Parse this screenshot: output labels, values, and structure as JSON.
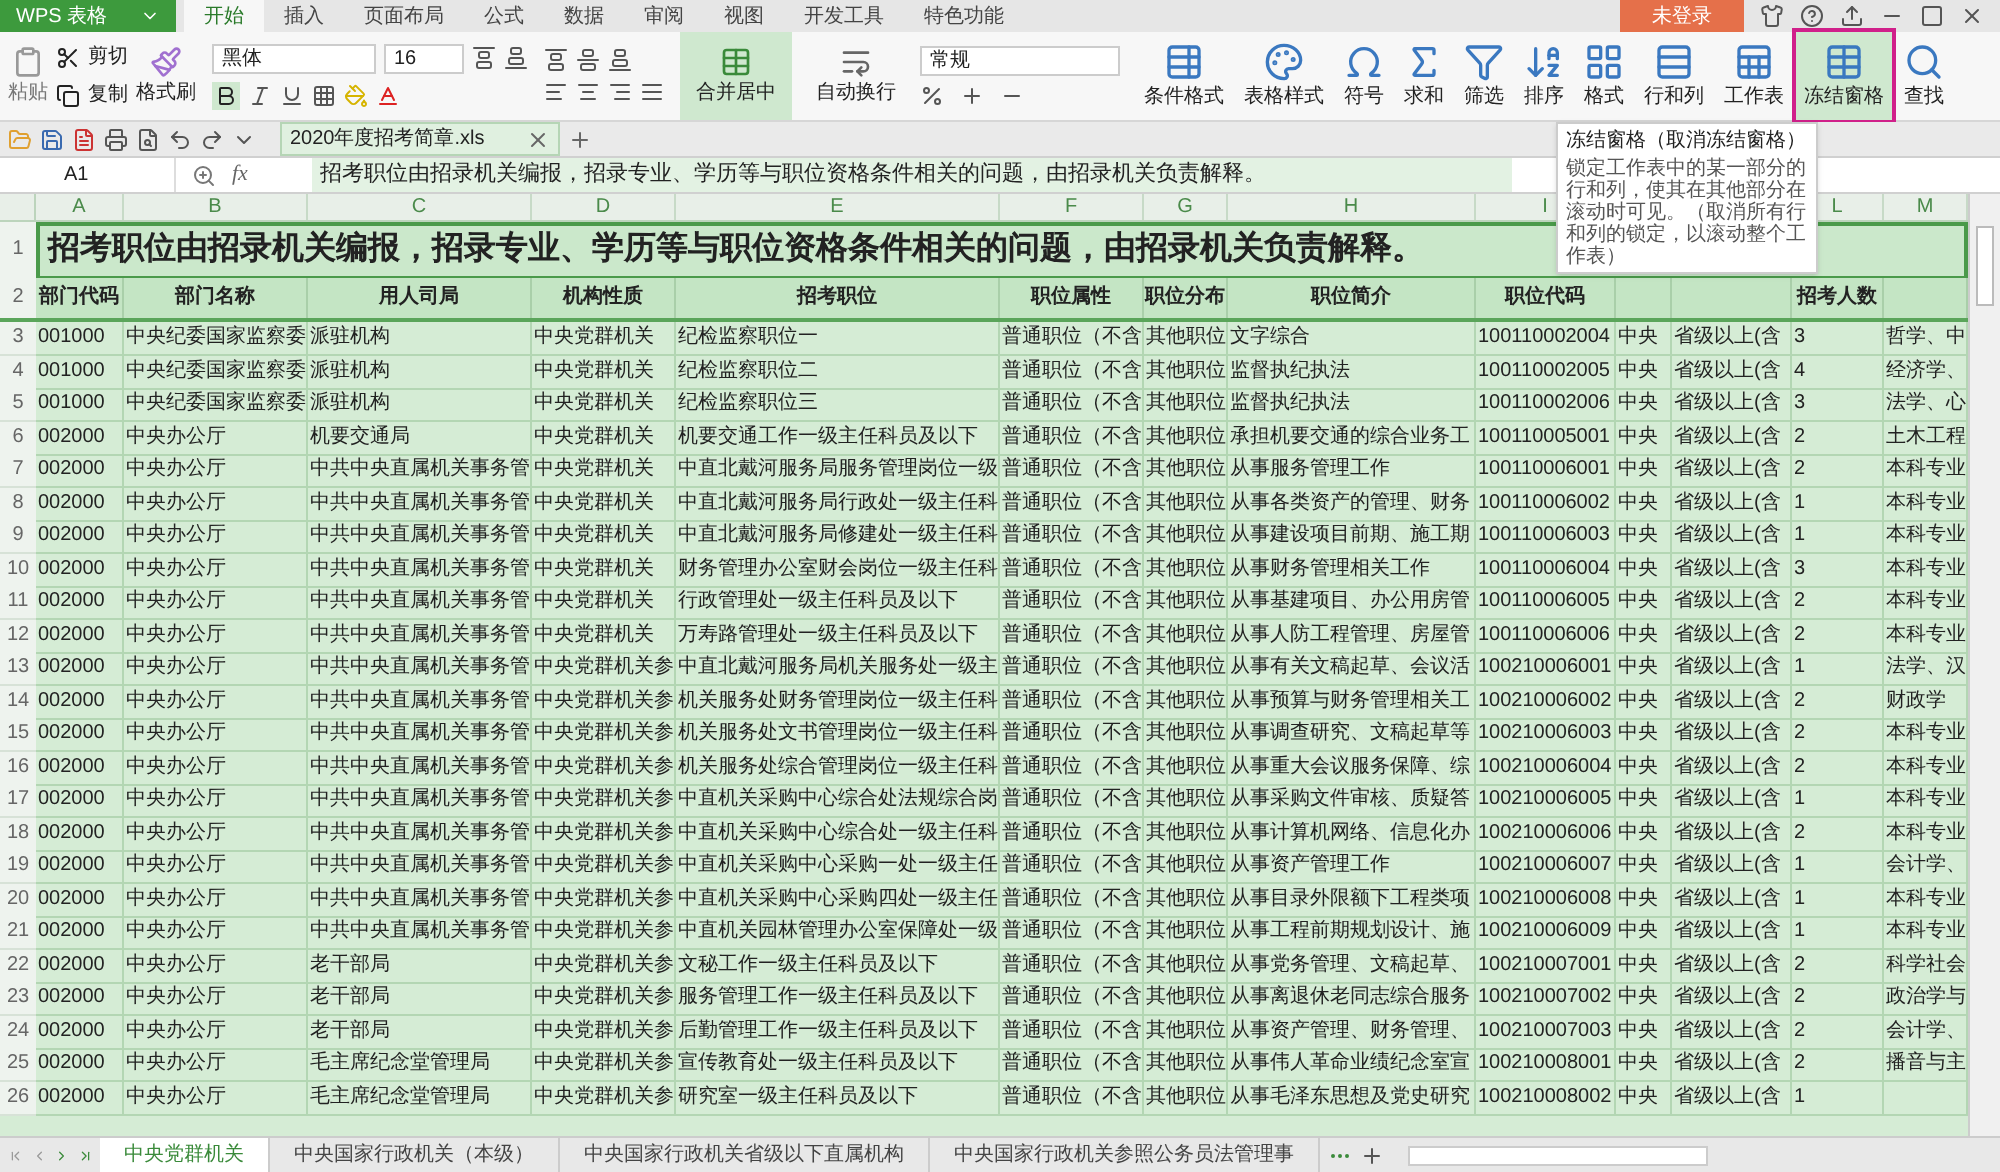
{
  "app": {
    "name": "WPS 表格"
  },
  "menu_tabs": [
    {
      "label": "开始",
      "selected": true
    },
    {
      "label": "插入",
      "selected": false
    },
    {
      "label": "页面布局",
      "selected": false
    },
    {
      "label": "公式",
      "selected": false
    },
    {
      "label": "数据",
      "selected": false
    },
    {
      "label": "审阅",
      "selected": false
    },
    {
      "label": "视图",
      "selected": false
    },
    {
      "label": "开发工具",
      "selected": false
    },
    {
      "label": "特色功能",
      "selected": false
    }
  ],
  "login_button": "未登录",
  "ribbon": {
    "paste": "粘贴",
    "cut": "剪切",
    "copy": "复制",
    "format_painter": "格式刷",
    "font_name": "黑体",
    "font_size": "16",
    "bold": true,
    "merge": {
      "label": "合并居中",
      "selected": true
    },
    "wrap": {
      "label": "自动换行",
      "selected": false
    },
    "number_format": "常规",
    "tools": [
      {
        "kind": "conditional",
        "label": "条件格式",
        "selected": false
      },
      {
        "kind": "style",
        "label": "表格样式",
        "selected": false
      },
      {
        "kind": "symbol",
        "label": "符号",
        "selected": false
      },
      {
        "kind": "sum",
        "label": "求和",
        "selected": false
      },
      {
        "kind": "filter",
        "label": "筛选",
        "selected": false
      },
      {
        "kind": "sort",
        "label": "排序",
        "selected": false
      },
      {
        "kind": "format",
        "label": "格式",
        "selected": false
      },
      {
        "kind": "rowcol",
        "label": "行和列",
        "selected": false
      },
      {
        "kind": "sheet",
        "label": "工作表",
        "selected": false
      },
      {
        "kind": "freeze",
        "label": "冻结窗格",
        "selected": true
      },
      {
        "kind": "find",
        "label": "查找",
        "selected": false
      }
    ]
  },
  "document_tab": {
    "title": "2020年度招考简章.xls"
  },
  "formula_bar": {
    "cell": "A1",
    "fx": "fx",
    "content": "招考职位由招录机关编报，招录专业、学历等与职位资格条件相关的问题，由招录机关负责解释。"
  },
  "tooltip": {
    "title": "冻结窗格（取消冻结窗格）",
    "body": "锁定工作表中的某一部分的行和列，使其在其他部分在滚动时可见。（取消所有行和列的锁定，以滚动整个工作表）"
  },
  "sheet": {
    "columns": [
      "A",
      "B",
      "C",
      "D",
      "E",
      "F",
      "G",
      "H",
      "I",
      null,
      null,
      "L",
      "M"
    ],
    "title_row": {
      "num": "1",
      "text": "招考职位由招录机关编报，招录专业、学历等与职位资格条件相关的问题，由招录机关负责解释。"
    },
    "header_row": {
      "num": "2",
      "cells": [
        "部门代码",
        "部门名称",
        "用人司局",
        "机构性质",
        "招考职位",
        "职位属性",
        "职位分布",
        "职位简介",
        "职位代码",
        null,
        null,
        "招考人数"
      ]
    },
    "rows": [
      {
        "num": "3",
        "cells": [
          "001000",
          "中央纪委国家监察委",
          "派驻机构",
          "中央党群机关",
          "纪检监察职位一",
          "普通职位（不含",
          "其他职位",
          "文字综合",
          "100110002004",
          "中央",
          "省级以上(含",
          "3",
          "哲学、中"
        ]
      },
      {
        "num": "4",
        "cells": [
          "001000",
          "中央纪委国家监察委",
          "派驻机构",
          "中央党群机关",
          "纪检监察职位二",
          "普通职位（不含",
          "其他职位",
          "监督执纪执法",
          "100110002005",
          "中央",
          "省级以上(含",
          "4",
          "经济学、"
        ]
      },
      {
        "num": "5",
        "cells": [
          "001000",
          "中央纪委国家监察委",
          "派驻机构",
          "中央党群机关",
          "纪检监察职位三",
          "普通职位（不含",
          "其他职位",
          "监督执纪执法",
          "100110002006",
          "中央",
          "省级以上(含",
          "3",
          "法学、心"
        ]
      },
      {
        "num": "6",
        "cells": [
          "002000",
          "中央办公厅",
          "机要交通局",
          "中央党群机关",
          "机要交通工作一级主任科员及以下",
          "普通职位（不含",
          "其他职位",
          "承担机要交通的综合业务工",
          "100110005001",
          "中央",
          "省级以上(含",
          "2",
          "土木工程"
        ]
      },
      {
        "num": "7",
        "cells": [
          "002000",
          "中央办公厅",
          "中共中央直属机关事务管",
          "中央党群机关",
          "中直北戴河服务局服务管理岗位一级",
          "普通职位（不含",
          "其他职位",
          "从事服务管理工作",
          "100110006001",
          "中央",
          "省级以上(含",
          "2",
          "本科专业"
        ]
      },
      {
        "num": "8",
        "cells": [
          "002000",
          "中央办公厅",
          "中共中央直属机关事务管",
          "中央党群机关",
          "中直北戴河服务局行政处一级主任科",
          "普通职位（不含",
          "其他职位",
          "从事各类资产的管理、财务",
          "100110006002",
          "中央",
          "省级以上(含",
          "1",
          "本科专业"
        ]
      },
      {
        "num": "9",
        "cells": [
          "002000",
          "中央办公厅",
          "中共中央直属机关事务管",
          "中央党群机关",
          "中直北戴河服务局修建处一级主任科",
          "普通职位（不含",
          "其他职位",
          "从事建设项目前期、施工期",
          "100110006003",
          "中央",
          "省级以上(含",
          "1",
          "本科专业"
        ]
      },
      {
        "num": "10",
        "cells": [
          "002000",
          "中央办公厅",
          "中共中央直属机关事务管",
          "中央党群机关",
          "财务管理办公室财会岗位一级主任科",
          "普通职位（不含",
          "其他职位",
          "从事财务管理相关工作",
          "100110006004",
          "中央",
          "省级以上(含",
          "3",
          "本科专业"
        ]
      },
      {
        "num": "11",
        "cells": [
          "002000",
          "中央办公厅",
          "中共中央直属机关事务管",
          "中央党群机关",
          "行政管理处一级主任科员及以下",
          "普通职位（不含",
          "其他职位",
          "从事基建项目、办公用房管",
          "100110006005",
          "中央",
          "省级以上(含",
          "2",
          "本科专业"
        ]
      },
      {
        "num": "12",
        "cells": [
          "002000",
          "中央办公厅",
          "中共中央直属机关事务管",
          "中央党群机关",
          "万寿路管理处一级主任科员及以下",
          "普通职位（不含",
          "其他职位",
          "从事人防工程管理、房屋管",
          "100110006006",
          "中央",
          "省级以上(含",
          "2",
          "本科专业"
        ]
      },
      {
        "num": "13",
        "cells": [
          "002000",
          "中央办公厅",
          "中共中央直属机关事务管",
          "中央党群机关参",
          "中直北戴河服务局机关服务处一级主",
          "普通职位（不含",
          "其他职位",
          "从事有关文稿起草、会议活",
          "100210006001",
          "中央",
          "省级以上(含",
          "1",
          "法学、汉"
        ]
      },
      {
        "num": "14",
        "cells": [
          "002000",
          "中央办公厅",
          "中共中央直属机关事务管",
          "中央党群机关参",
          "机关服务处财务管理岗位一级主任科",
          "普通职位（不含",
          "其他职位",
          "从事预算与财务管理相关工",
          "100210006002",
          "中央",
          "省级以上(含",
          "2",
          "财政学"
        ]
      },
      {
        "num": "15",
        "cells": [
          "002000",
          "中央办公厅",
          "中共中央直属机关事务管",
          "中央党群机关参",
          "机关服务处文书管理岗位一级主任科",
          "普通职位（不含",
          "其他职位",
          "从事调查研究、文稿起草等",
          "100210006003",
          "中央",
          "省级以上(含",
          "2",
          "本科专业"
        ]
      },
      {
        "num": "16",
        "cells": [
          "002000",
          "中央办公厅",
          "中共中央直属机关事务管",
          "中央党群机关参",
          "机关服务处综合管理岗位一级主任科",
          "普通职位（不含",
          "其他职位",
          "从事重大会议服务保障、综",
          "100210006004",
          "中央",
          "省级以上(含",
          "2",
          "本科专业"
        ]
      },
      {
        "num": "17",
        "cells": [
          "002000",
          "中央办公厅",
          "中共中央直属机关事务管",
          "中央党群机关参",
          "中直机关采购中心综合处法规综合岗",
          "普通职位（不含",
          "其他职位",
          "从事采购文件审核、质疑答",
          "100210006005",
          "中央",
          "省级以上(含",
          "1",
          "本科专业"
        ]
      },
      {
        "num": "18",
        "cells": [
          "002000",
          "中央办公厅",
          "中共中央直属机关事务管",
          "中央党群机关参",
          "中直机关采购中心综合处一级主任科",
          "普通职位（不含",
          "其他职位",
          "从事计算机网络、信息化办",
          "100210006006",
          "中央",
          "省级以上(含",
          "2",
          "本科专业"
        ]
      },
      {
        "num": "19",
        "cells": [
          "002000",
          "中央办公厅",
          "中共中央直属机关事务管",
          "中央党群机关参",
          "中直机关采购中心采购一处一级主任",
          "普通职位（不含",
          "其他职位",
          "从事资产管理工作",
          "100210006007",
          "中央",
          "省级以上(含",
          "1",
          "会计学、"
        ]
      },
      {
        "num": "20",
        "cells": [
          "002000",
          "中央办公厅",
          "中共中央直属机关事务管",
          "中央党群机关参",
          "中直机关采购中心采购四处一级主任",
          "普通职位（不含",
          "其他职位",
          "从事目录外限额下工程类项",
          "100210006008",
          "中央",
          "省级以上(含",
          "1",
          "本科专业"
        ]
      },
      {
        "num": "21",
        "cells": [
          "002000",
          "中央办公厅",
          "中共中央直属机关事务管",
          "中央党群机关参",
          "中直机关园林管理办公室保障处一级",
          "普通职位（不含",
          "其他职位",
          "从事工程前期规划设计、施",
          "100210006009",
          "中央",
          "省级以上(含",
          "1",
          "本科专业"
        ]
      },
      {
        "num": "22",
        "cells": [
          "002000",
          "中央办公厅",
          "老干部局",
          "中央党群机关参",
          "文秘工作一级主任科员及以下",
          "普通职位（不含",
          "其他职位",
          "从事党务管理、文稿起草、",
          "100210007001",
          "中央",
          "省级以上(含",
          "2",
          "科学社会"
        ]
      },
      {
        "num": "23",
        "cells": [
          "002000",
          "中央办公厅",
          "老干部局",
          "中央党群机关参",
          "服务管理工作一级主任科员及以下",
          "普通职位（不含",
          "其他职位",
          "从事离退休老同志综合服务",
          "100210007002",
          "中央",
          "省级以上(含",
          "2",
          "政治学与"
        ]
      },
      {
        "num": "24",
        "cells": [
          "002000",
          "中央办公厅",
          "老干部局",
          "中央党群机关参",
          "后勤管理工作一级主任科员及以下",
          "普通职位（不含",
          "其他职位",
          "从事资产管理、财务管理、",
          "100210007003",
          "中央",
          "省级以上(含",
          "2",
          "会计学、"
        ]
      },
      {
        "num": "25",
        "cells": [
          "002000",
          "中央办公厅",
          "毛主席纪念堂管理局",
          "中央党群机关参",
          "宣传教育处一级主任科员及以下",
          "普通职位（不含",
          "其他职位",
          "从事伟人革命业绩纪念室宣",
          "100210008001",
          "中央",
          "省级以上(含",
          "2",
          "播音与主"
        ]
      },
      {
        "num": "26",
        "cells": [
          "002000",
          "中央办公厅",
          "毛主席纪念堂管理局",
          "中央党群机关参",
          "研究室一级主任科员及以下",
          "普通职位（不含",
          "其他职位",
          "从事毛泽东思想及党史研究",
          "100210008002",
          "中央",
          "省级以上(含",
          "1"
        ]
      }
    ]
  },
  "sheet_tabs": [
    {
      "label": "中央党群机关",
      "selected": true
    },
    {
      "label": "中央国家行政机关（本级）",
      "selected": false
    },
    {
      "label": "中央国家行政机关省级以下直属机构",
      "selected": false
    },
    {
      "label": "中央国家行政机关参照公务员法管理事",
      "selected": false
    }
  ]
}
